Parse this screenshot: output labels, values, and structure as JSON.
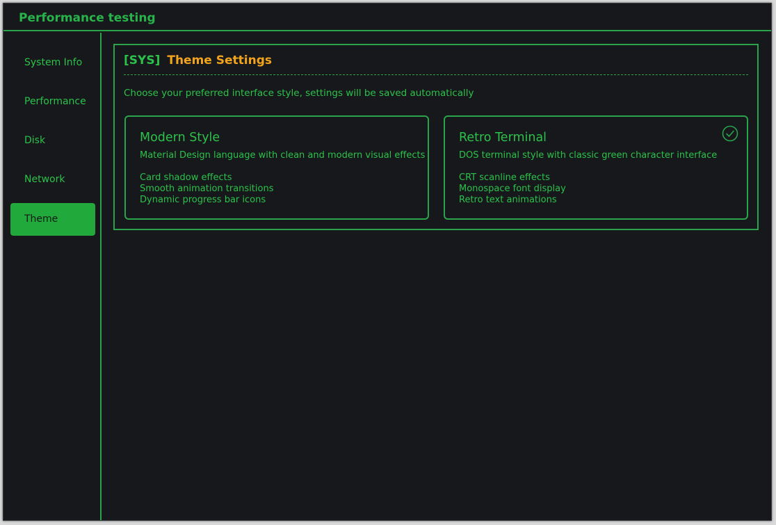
{
  "window": {
    "title": "Performance testing"
  },
  "sidebar": {
    "items": [
      {
        "label": "System Info",
        "active": false
      },
      {
        "label": "Performance",
        "active": false
      },
      {
        "label": "Disk",
        "active": false
      },
      {
        "label": "Network",
        "active": false
      },
      {
        "label": "Theme",
        "active": true
      }
    ]
  },
  "panel": {
    "tag": "[SYS]",
    "title": "Theme Settings",
    "subtitle": "Choose your preferred interface style, settings will be saved automatically"
  },
  "themes": [
    {
      "title": "Modern Style",
      "description": "Material Design language with clean and modern visual effects",
      "features": [
        "Card shadow effects",
        "Smooth animation transitions",
        "Dynamic progress bar icons"
      ],
      "selected": false
    },
    {
      "title": "Retro Terminal",
      "description": "DOS terminal style with classic green character interface",
      "features": [
        "CRT scanline effects",
        "Monospace font display",
        "Retro text animations"
      ],
      "selected": true,
      "selected_icon": "check-circle-icon"
    }
  ],
  "colors": {
    "background": "#17181c",
    "accent_green": "#2bc24a",
    "active_nav_bg": "#21a93c",
    "title_orange": "#f2a51c"
  }
}
